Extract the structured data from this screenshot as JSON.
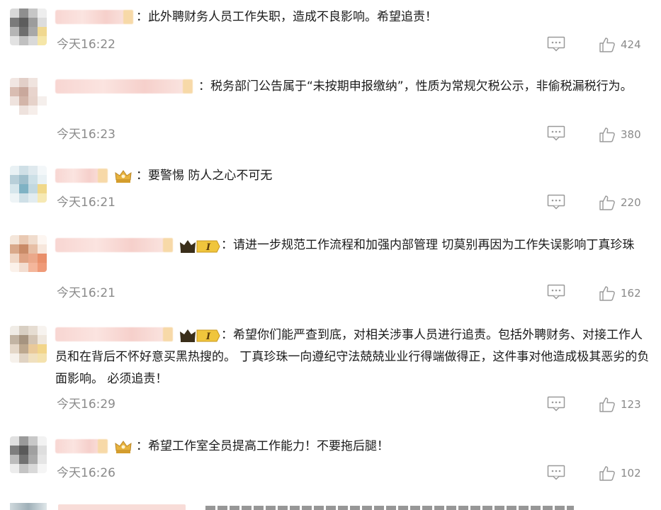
{
  "comments": [
    {
      "text": "：此外聘财务人员工作失职，造成不良影响。希望追责！",
      "time": "今天16:22",
      "likes": "424",
      "badge": "none"
    },
    {
      "text": "：税务部门公告属于“未按期申报缴纳”，性质为常规欠税公示，非偷税漏税行为。",
      "time": "今天16:23",
      "likes": "380",
      "badge": "none"
    },
    {
      "text": "：要警惕 防人之心不可无",
      "time": "今天16:21",
      "likes": "220",
      "badge": "crown"
    },
    {
      "text": "：请进一步规范工作流程和加强内部管理 切莫别再因为工作失误影响丁真珍珠",
      "time": "今天16:21",
      "likes": "162",
      "badge": "level"
    },
    {
      "text": "：希望你们能严查到底，对相关涉事人员进行追责。包括外聘财务、对接工作人员和在背后不怀好意买黑热搜的。 丁真珍珠一向遵纪守法兢兢业业行得端做得正，这件事对他造成极其恶劣的负面影响。 必须追责！",
      "time": "今天16:29",
      "likes": "123",
      "badge": "level"
    },
    {
      "text": "：希望工作室全员提高工作能力！不要拖后腿！",
      "time": "今天16:26",
      "likes": "102",
      "badge": "crown"
    }
  ],
  "colors": {
    "time": "#8a8a8a",
    "text": "#1a1a1a",
    "icon": "#9a9a9a"
  },
  "icons": {
    "reply": "comment-icon",
    "like": "thumbs-up-icon",
    "crown": "vip-crown-icon",
    "level": "level-badge-icon"
  }
}
